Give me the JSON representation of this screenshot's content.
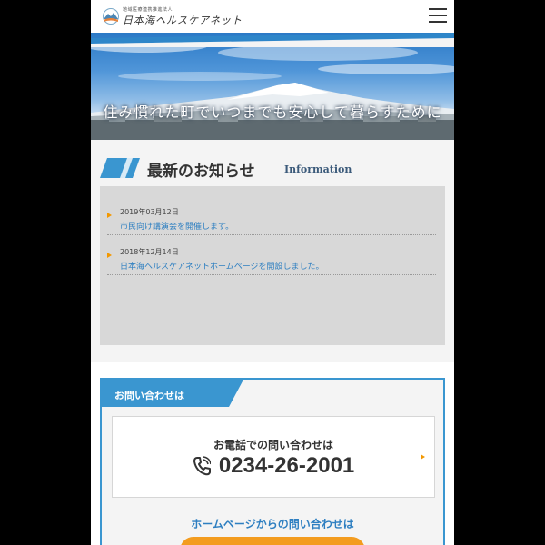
{
  "header": {
    "org_type": "地域医療連携推進法人",
    "org_name": "日本海ヘルスケアネット",
    "menu_icon": "hamburger-menu-icon"
  },
  "hero": {
    "catchphrase": "住み慣れた町でいつまでも安心して暮らすために"
  },
  "news": {
    "title": "最新のお知らせ",
    "title_en": "Information",
    "items": [
      {
        "date": "2019年03月12日",
        "text": "市民向け講演会を開催します。"
      },
      {
        "date": "2018年12月14日",
        "text": "日本海ヘルスケアネットホームページを開設しました。"
      }
    ]
  },
  "contact": {
    "header_label": "お問い合わせは",
    "phone_title": "お電話での問い合わせは",
    "phone_number": "0234-26-2001",
    "phone_icon": "telephone-icon",
    "web_title": "ホームページからの問い合わせは"
  },
  "colors": {
    "accent_blue": "#3a96d0",
    "link_blue": "#2e7fc1",
    "accent_orange": "#f39800",
    "background": "#000000"
  }
}
